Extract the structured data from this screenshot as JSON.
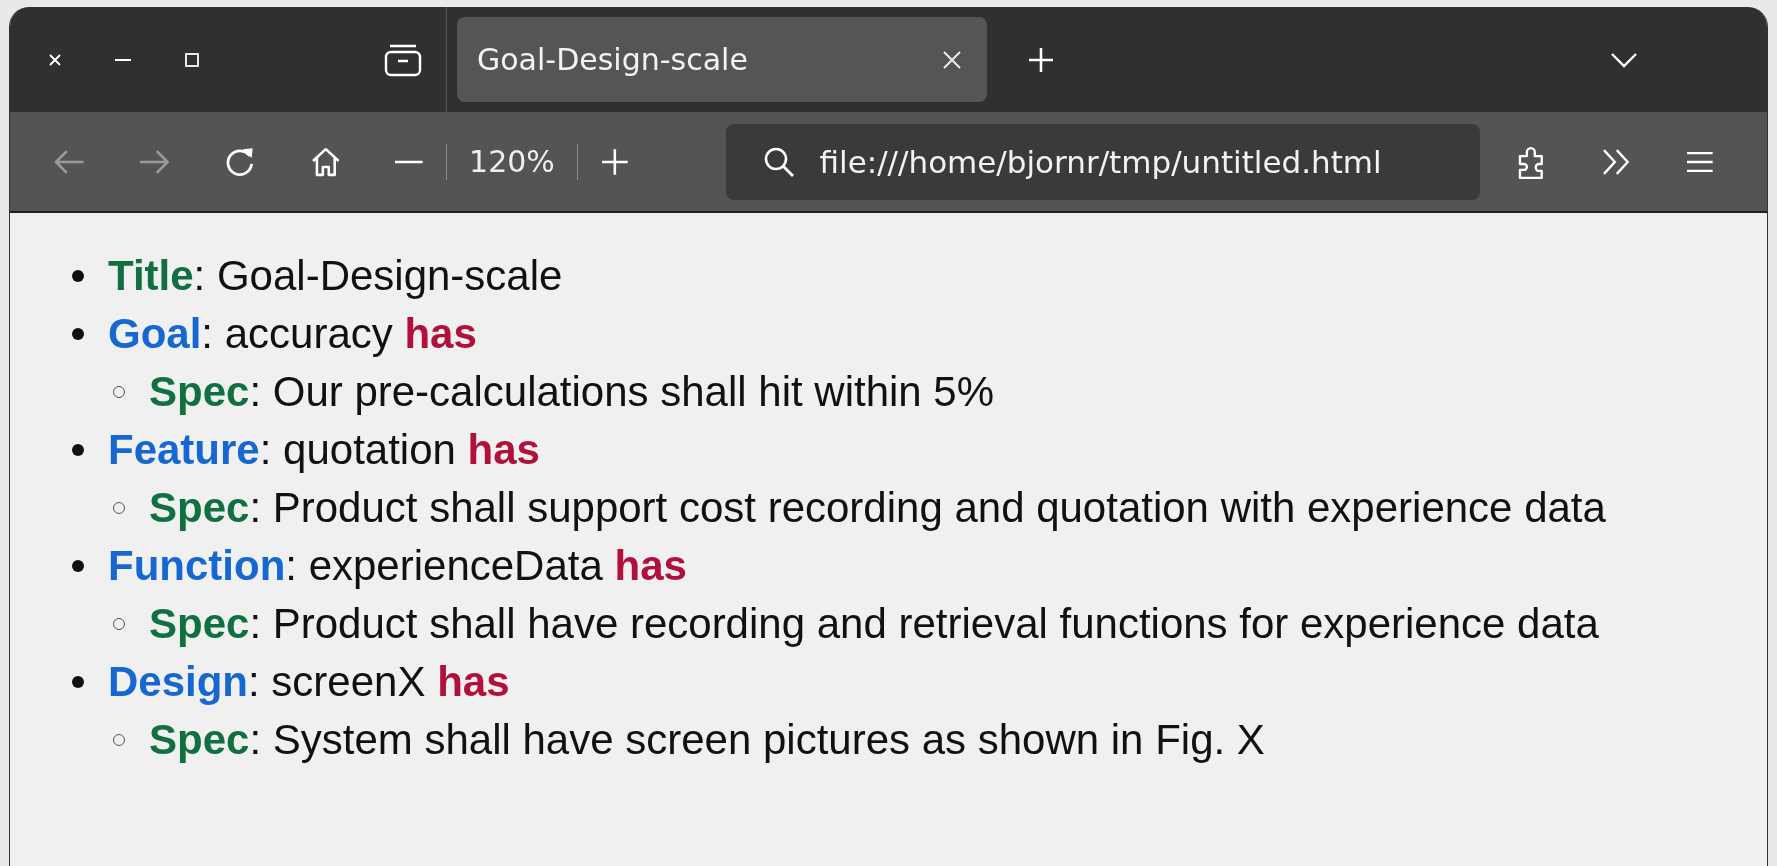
{
  "window": {
    "controls": [
      {
        "kind": "close"
      },
      {
        "kind": "minimize"
      },
      {
        "kind": "maximize"
      }
    ]
  },
  "tabs": [
    {
      "title": "Goal-Design-scale",
      "selected": true
    }
  ],
  "toolbar": {
    "zoom": "120%",
    "url": "file:///home/bjornr/tmp/untitled.html"
  },
  "items": [
    {
      "key": "Title",
      "color": "#10703f",
      "text": ": Goal-Design-scale"
    },
    {
      "key": "Goal",
      "color": "#1668d0",
      "text": ": accuracy ",
      "relation": "has",
      "children": [
        {
          "key": "Spec",
          "color": "#10703f",
          "text": ": Our pre-calculations shall hit within 5%"
        }
      ]
    },
    {
      "key": "Feature",
      "color": "#1668d0",
      "text": ": quotation ",
      "relation": "has",
      "children": [
        {
          "key": "Spec",
          "color": "#10703f",
          "text": ": Product shall support cost recording and quotation with experience data"
        }
      ]
    },
    {
      "key": "Function",
      "color": "#1668d0",
      "text": ": experienceData ",
      "relation": "has",
      "children": [
        {
          "key": "Spec",
          "color": "#10703f",
          "text": ": Product shall have recording and retrieval functions for experience data"
        }
      ]
    },
    {
      "key": "Design",
      "color": "#1668d0",
      "text": ": screenX ",
      "relation": "has",
      "children": [
        {
          "key": "Spec",
          "color": "#10703f",
          "text": ": System shall have screen pictures as shown in Fig. X"
        }
      ]
    }
  ]
}
